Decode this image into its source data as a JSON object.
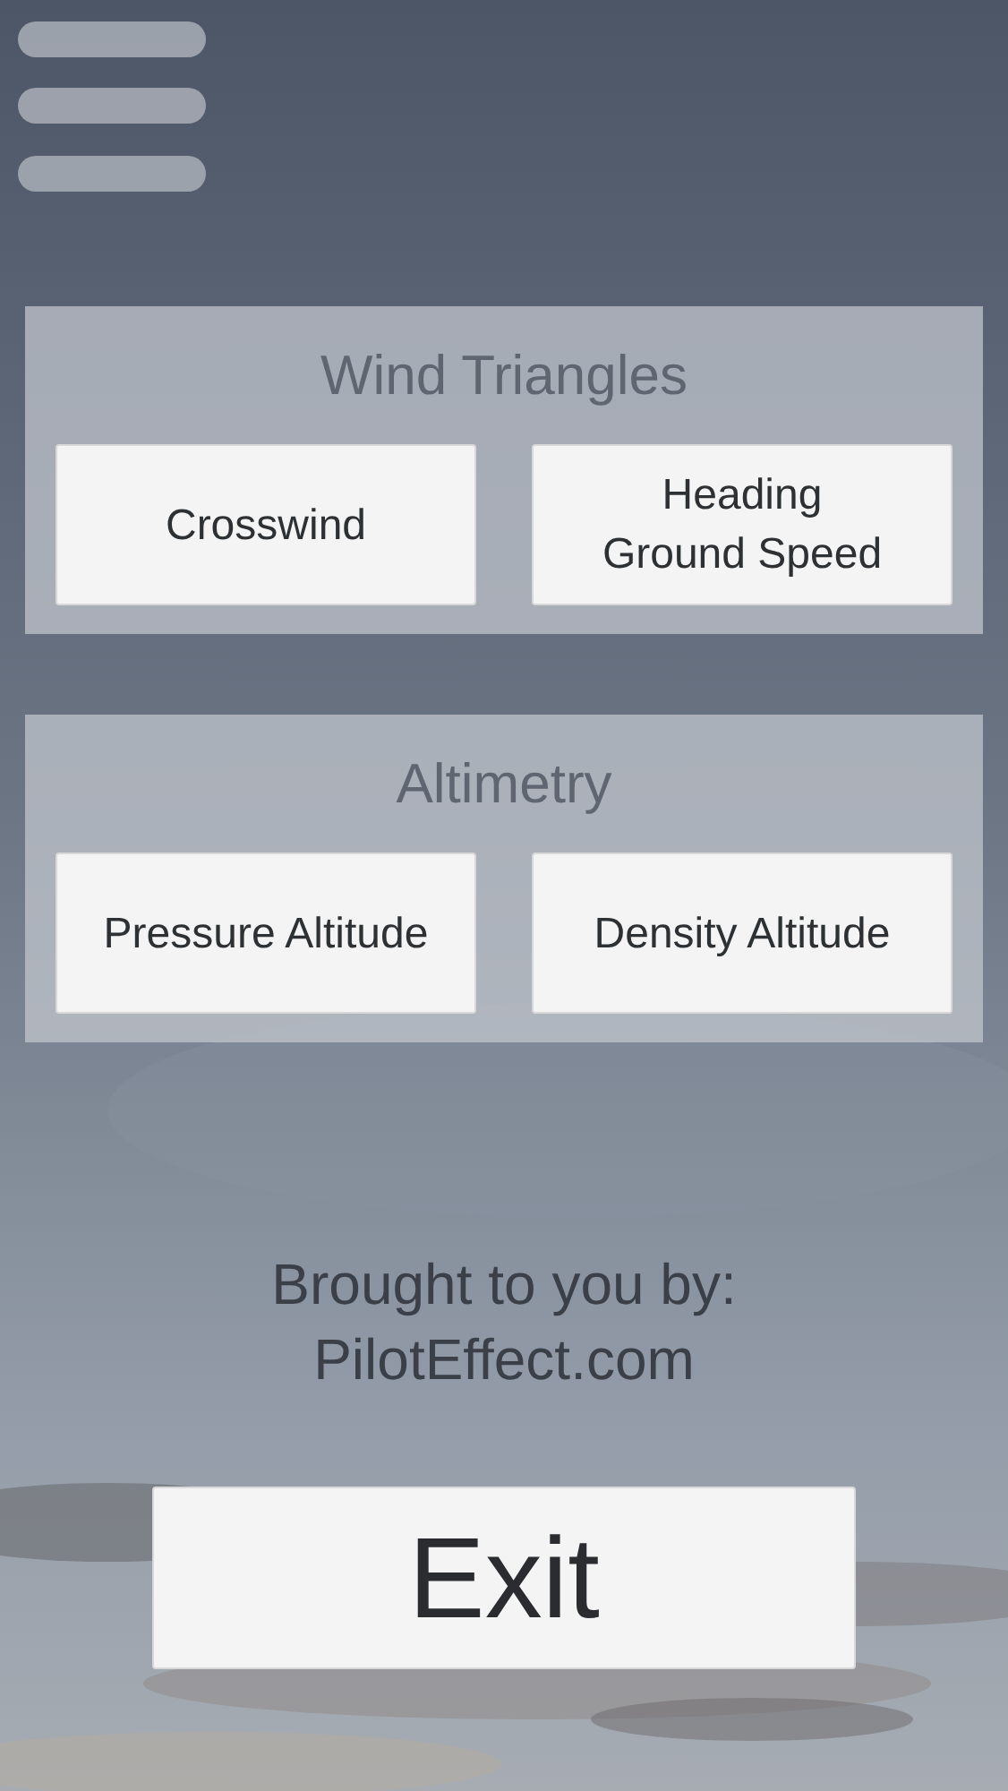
{
  "sections": [
    {
      "title": "Wind Triangles",
      "buttons": [
        "Crosswind",
        "Heading\nGround Speed"
      ]
    },
    {
      "title": "Altimetry",
      "buttons": [
        "Pressure Altitude",
        "Density Altitude"
      ]
    }
  ],
  "credit": {
    "line_1": "Brought to you by:",
    "line_2": "PilotEffect.com"
  },
  "exit_button": "Exit"
}
